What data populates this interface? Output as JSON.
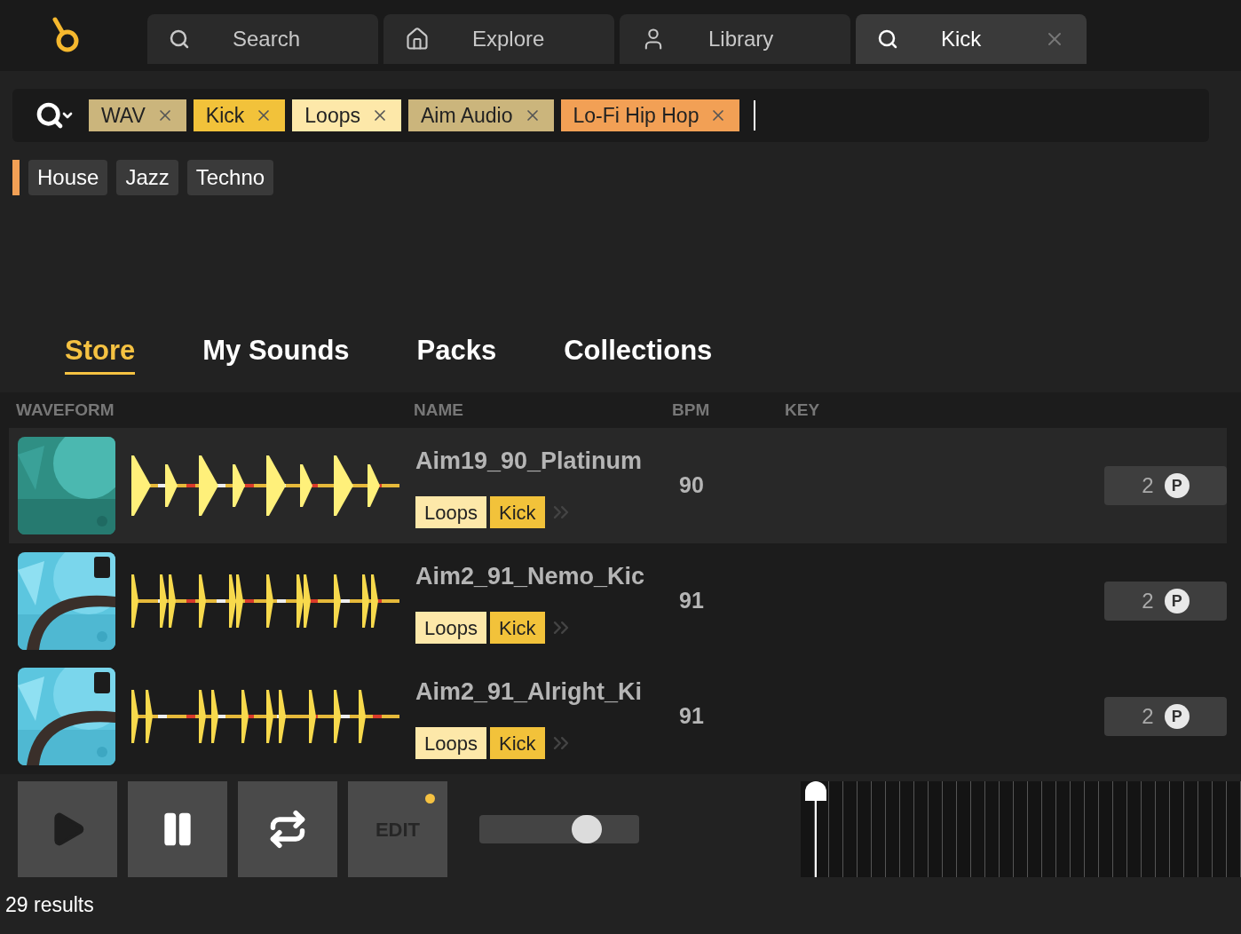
{
  "nav_tabs": [
    {
      "kind": "search",
      "label": "Search",
      "selected": false
    },
    {
      "kind": "home",
      "label": "Explore",
      "selected": false
    },
    {
      "kind": "user",
      "label": "Library",
      "selected": false
    },
    {
      "kind": "search",
      "label": "Kick",
      "selected": true,
      "closable": true
    }
  ],
  "filter_tags": [
    {
      "label": "WAV",
      "color": "#cbb57c"
    },
    {
      "label": "Kick",
      "color": "#f2c23a"
    },
    {
      "label": "Loops",
      "color": "#fde8a9"
    },
    {
      "label": "Aim Audio",
      "color": "#cbb57c"
    },
    {
      "label": "Lo-Fi Hip Hop",
      "color": "#f2a055"
    }
  ],
  "suggestions": [
    "House",
    "Jazz",
    "Techno"
  ],
  "section_tabs": [
    {
      "label": "Store",
      "selected": true
    },
    {
      "label": "My Sounds",
      "selected": false
    },
    {
      "label": "Packs",
      "selected": false
    },
    {
      "label": "Collections",
      "selected": false
    }
  ],
  "table": {
    "columns": [
      "WAVEFORM",
      "NAME",
      "BPM",
      "KEY"
    ],
    "rows": [
      {
        "selected": true,
        "name": "Aim19_90_Platinum",
        "bpm": "90",
        "credits": "2",
        "credit_mark": "P",
        "tags": [
          {
            "label": "Loops",
            "color": "#fde8a9"
          },
          {
            "label": "Kick",
            "color": "#f2c23a"
          }
        ]
      },
      {
        "selected": false,
        "name": "Aim2_91_Nemo_Kic",
        "bpm": "91",
        "credits": "2",
        "credit_mark": "P",
        "tags": [
          {
            "label": "Loops",
            "color": "#fde8a9"
          },
          {
            "label": "Kick",
            "color": "#f2c23a"
          }
        ]
      },
      {
        "selected": false,
        "name": "Aim2_91_Alright_Ki",
        "bpm": "91",
        "credits": "2",
        "credit_mark": "P",
        "tags": [
          {
            "label": "Loops",
            "color": "#fde8a9"
          },
          {
            "label": "Kick",
            "color": "#f2c23a"
          }
        ]
      }
    ]
  },
  "player": {
    "edit_label": "EDIT",
    "edit_pending": true,
    "volume": {
      "level": 0.67
    },
    "timeline": {
      "level": 0.035
    }
  },
  "status_bar": "29 results"
}
